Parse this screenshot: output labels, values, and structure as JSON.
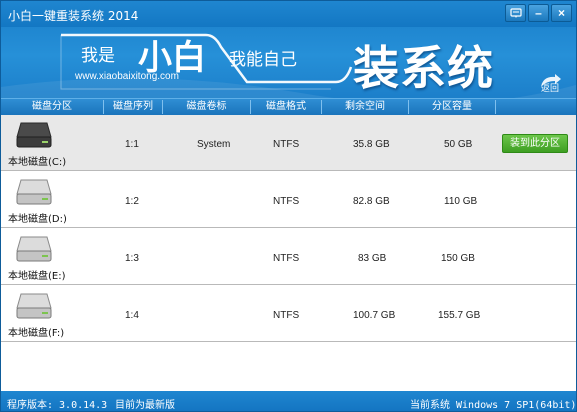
{
  "window": {
    "title": "小白一键重装系统 2014"
  },
  "titlebar_controls": [
    {
      "name": "menu-button",
      "icon": "menu-icon"
    },
    {
      "name": "minimize-button",
      "icon": "minimize-icon",
      "glyph": "–"
    },
    {
      "name": "close-button",
      "icon": "close-icon",
      "glyph": "×"
    }
  ],
  "banner": {
    "slogan_part1": "我是",
    "slogan_part2": "小白",
    "slogan_part3": "我能自己",
    "site_url": "www.xiaobaixitong.com",
    "big_title": "装系统",
    "back_label": "返回"
  },
  "table": {
    "headers": [
      "磁盘分区",
      "磁盘序列",
      "磁盘卷标",
      "磁盘格式",
      "剩余空间",
      "分区容量"
    ],
    "rows": [
      {
        "drive": "本地磁盘(C:)",
        "seq": "1:1",
        "label": "System",
        "format": "NTFS",
        "free": "35.8 GB",
        "size": "50 GB",
        "selected": true,
        "action": "装到此分区"
      },
      {
        "drive": "本地磁盘(D:)",
        "seq": "1:2",
        "label": "",
        "format": "NTFS",
        "free": "82.8 GB",
        "size": "110 GB",
        "selected": false
      },
      {
        "drive": "本地磁盘(E:)",
        "seq": "1:3",
        "label": "",
        "format": "NTFS",
        "free": "83 GB",
        "size": "150 GB",
        "selected": false
      },
      {
        "drive": "本地磁盘(F:)",
        "seq": "1:4",
        "label": "",
        "format": "NTFS",
        "free": "100.7 GB",
        "size": "155.7 GB",
        "selected": false
      }
    ]
  },
  "status": {
    "version": "程序版本: 3.0.14.3",
    "update": "目前为最新版",
    "current_system": "当前系统 Windows 7 SP1(64bit)"
  },
  "colors": {
    "titlebar": "#1f86d0",
    "selected_row": "#e8e8e8",
    "install_button": "#4fae2f"
  }
}
